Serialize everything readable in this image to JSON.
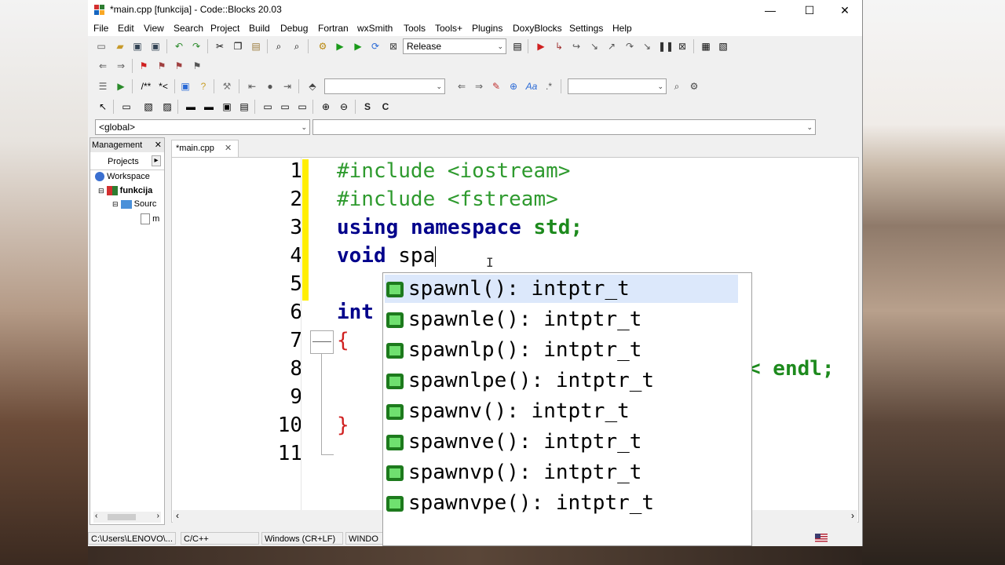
{
  "window": {
    "title": "*main.cpp [funkcija] - Code::Blocks 20.03",
    "minimize": "—",
    "maximize": "☐",
    "close": "✕"
  },
  "menu": [
    "File",
    "Edit",
    "View",
    "Search",
    "Project",
    "Build",
    "Debug",
    "Fortran",
    "wxSmith",
    "Tools",
    "Tools+",
    "Plugins",
    "DoxyBlocks",
    "Settings",
    "Help"
  ],
  "toolbar": {
    "build_target": "Release",
    "scope": "<global>",
    "function_combo": ""
  },
  "management": {
    "title": "Management",
    "close": "✕",
    "tab_projects": "Projects",
    "tab_arrow": "▸",
    "tree": [
      "Workspace",
      "funkcija",
      "Sourc",
      "m"
    ]
  },
  "editor": {
    "tab": "*main.cpp",
    "tab_close": "✕",
    "line_numbers": [
      "1",
      "2",
      "3",
      "4",
      "5",
      "6",
      "7",
      "8",
      "9",
      "10",
      "11"
    ],
    "lines": {
      "l1": "#include <iostream>",
      "l2": "#include <fstream>",
      "l3_kw1": "using",
      "l3_kw2": "namespace",
      "l3_std": "std;",
      "l4_kw": "void",
      "l4_rest": "spa",
      "l6_kw": "int",
      "l7": "{",
      "l8_tail": "< endl;",
      "l10": "}"
    }
  },
  "autocomplete": [
    {
      "name": "spawnl",
      "sig": "(): intptr_t"
    },
    {
      "name": "spawnle",
      "sig": "(): intptr_t"
    },
    {
      "name": "spawnlp",
      "sig": "(): intptr_t"
    },
    {
      "name": "spawnlpe",
      "sig": "(): intptr_t"
    },
    {
      "name": "spawnv",
      "sig": "(): intptr_t"
    },
    {
      "name": "spawnve",
      "sig": "(): intptr_t"
    },
    {
      "name": "spawnvp",
      "sig": "(): intptr_t"
    },
    {
      "name": "spawnvpe",
      "sig": "(): intptr_t"
    }
  ],
  "statusbar": {
    "path": "C:\\Users\\LENOVO\\...",
    "lang": "C/C++",
    "eol": "Windows (CR+LF)",
    "enc": "WINDO"
  },
  "colors": {
    "preprocessor": "#2e9a2e",
    "keyword": "#00008b",
    "selection": "#dce8fb",
    "modified_marker": "#ffee00"
  }
}
